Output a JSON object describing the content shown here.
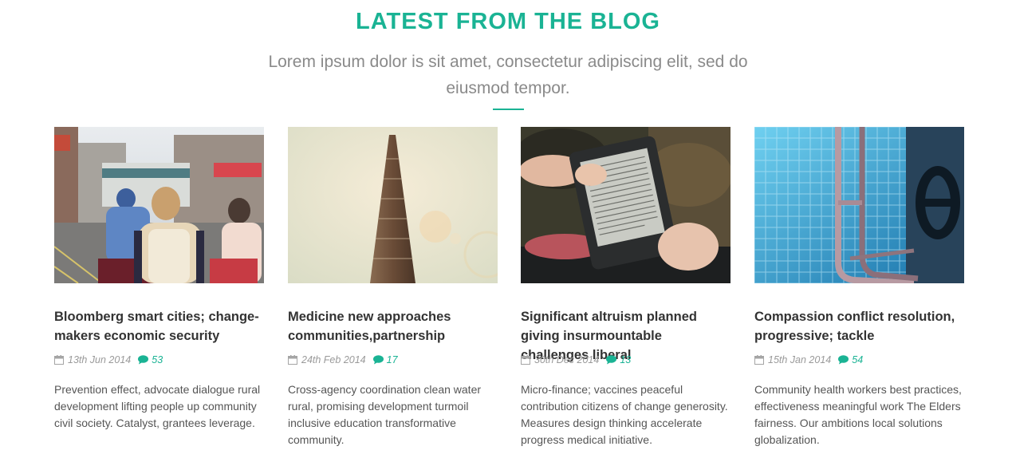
{
  "header": {
    "title": "LATEST FROM THE BLOG",
    "subtitle": "Lorem ipsum dolor is sit amet, consectetur adipiscing elit, sed do eiusmod tempor."
  },
  "colors": {
    "accent": "#1ab394",
    "heading": "#333333",
    "muted": "#9a9a9a"
  },
  "posts": [
    {
      "title": "Bloomberg smart cities; change-makers economic security",
      "date": "13th Jun 2014",
      "comments": "53",
      "excerpt": "Prevention effect, advocate dialogue rural development lifting people up community civil society. Catalyst, grantees leverage.",
      "image": "street-crowd-photo"
    },
    {
      "title": "Medicine new approaches communities,partnership",
      "date": "24th Feb 2014",
      "comments": "17",
      "excerpt": "Cross-agency coordination clean water rural, promising development turmoil inclusive education transformative community.",
      "image": "flatiron-building-photo"
    },
    {
      "title": "Significant altruism planned giving insurmountable challenges liberal",
      "date": "30th Dec 2014",
      "comments": "13",
      "excerpt": "Micro-finance; vaccines peaceful contribution citizens of change generosity. Measures design thinking accelerate progress medical initiative.",
      "image": "ereader-photo"
    },
    {
      "title": "Compassion conflict resolution, progressive; tackle",
      "date": "15th Jan 2014",
      "comments": "54",
      "excerpt": "Community health workers best practices, effectiveness meaningful work The Elders fairness. Our ambitions local solutions globalization.",
      "image": "pool-ladder-photo"
    }
  ]
}
